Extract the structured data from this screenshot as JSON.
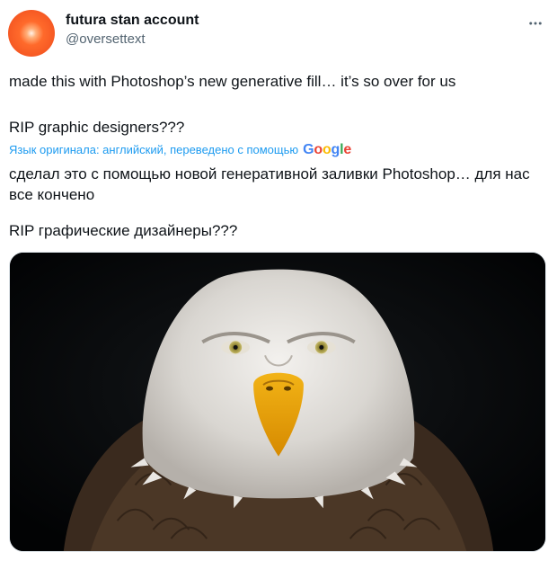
{
  "tweet": {
    "author": {
      "display_name": "futura stan account",
      "handle": "@oversettext",
      "avatar_color": "#ee4a1c"
    },
    "more_icon": "more-horizontal-icon",
    "original_text_line1": "made this with Photoshop’s new generative fill… it’s so over for us",
    "original_text_line2": "RIP graphic designers???",
    "translation_note": "Язык оригинала: английский, переведено с помощью",
    "translation_provider": "Google",
    "translated_text_line1": "сделал это с помощью новой генеративной заливки Photoshop… для нас все кончено",
    "translated_text_line2": "RIP графические дизайнеры???",
    "media": {
      "description_icon": "eagle-photo",
      "background_color": "#050607"
    }
  },
  "colors": {
    "link_blue": "#1d9bf0",
    "secondary_text": "#536471",
    "primary_text": "#0f1419"
  }
}
